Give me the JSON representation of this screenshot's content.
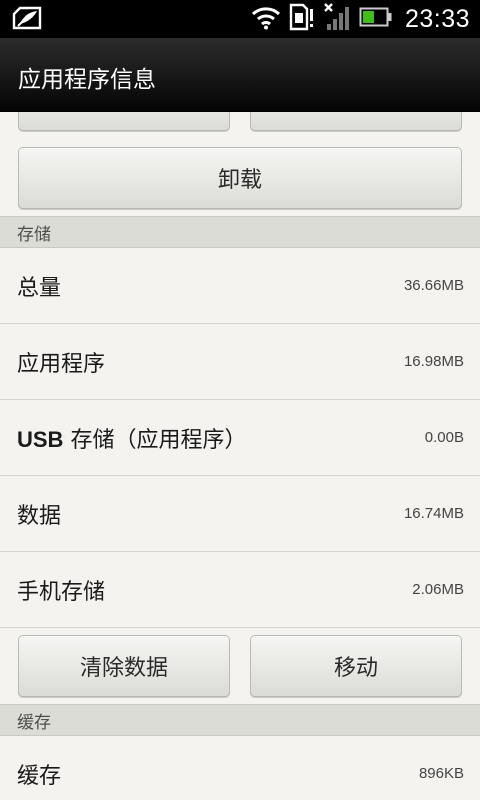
{
  "status_bar": {
    "time": "23:33",
    "icons": [
      "notification-icon",
      "wifi-icon",
      "sim-icon",
      "signal-icon",
      "battery-icon"
    ],
    "battery_color": "#3fbf16"
  },
  "header": {
    "title": "应用程序信息"
  },
  "actions": {
    "uninstall_label": "卸载"
  },
  "storage": {
    "section_title": "存储",
    "rows": [
      {
        "label": "总量",
        "value": "36.66MB"
      },
      {
        "label": "应用程序",
        "value": "16.98MB"
      },
      {
        "label_prefix": "USB",
        "label": " 存储（应用程序）",
        "value": "0.00B"
      },
      {
        "label": "数据",
        "value": "16.74MB"
      },
      {
        "label": "手机存储",
        "value": "2.06MB"
      }
    ],
    "clear_data_label": "清除数据",
    "move_label": "移动"
  },
  "cache": {
    "section_title": "缓存",
    "rows": [
      {
        "label": "缓存",
        "value": "896KB"
      }
    ]
  }
}
